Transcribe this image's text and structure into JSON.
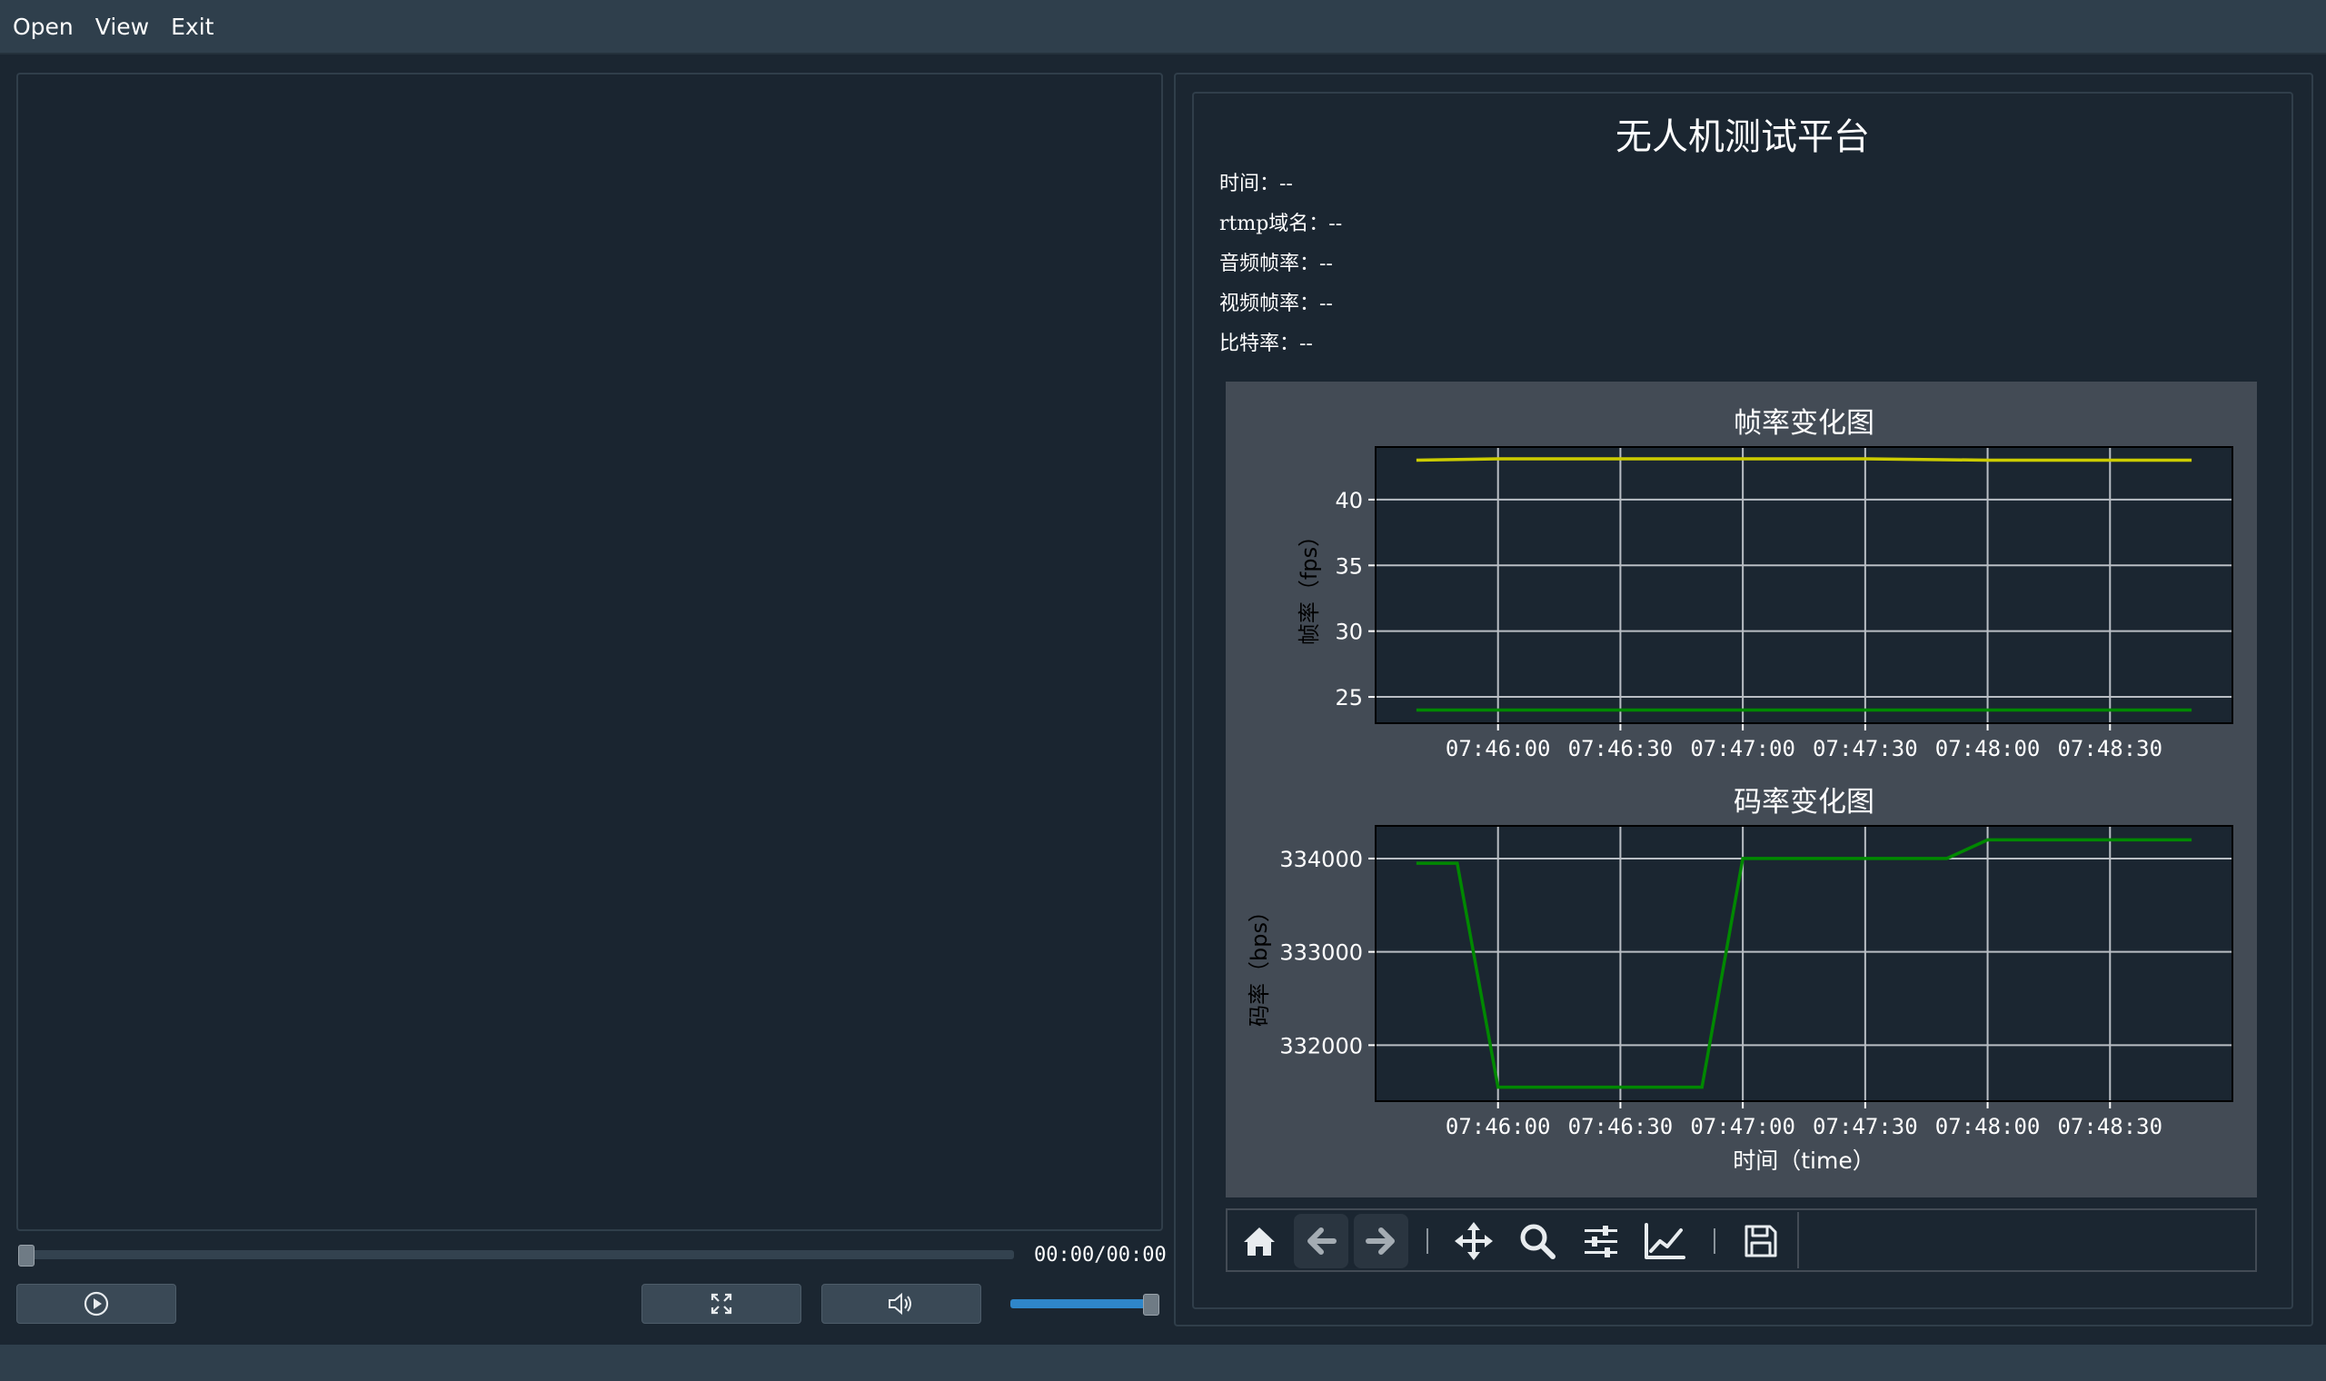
{
  "menu": {
    "items": [
      "Open",
      "View",
      "Exit"
    ]
  },
  "player": {
    "time_display": "00:00/00:00",
    "progress": 0,
    "volume": 1.0,
    "play_icon": "play-icon",
    "fullscreen_icon": "fullscreen-icon",
    "volume_icon": "speaker-icon"
  },
  "info": {
    "title": "无人机测试平台",
    "time_line": "时间：--",
    "rtmp_line": "rtmp域名：--",
    "audio_fps_line": "音频帧率：--",
    "video_fps_line": "视频帧率：--",
    "bitrate_line": "比特率：--"
  },
  "colors": {
    "fps_series_1": "#cccc00",
    "fps_series_2": "#008800",
    "bitrate_series": "#008800",
    "plot_background": "#1b2631",
    "figure_background": "#434b55"
  },
  "chart_data": [
    {
      "type": "line",
      "title": "帧率变化图",
      "xlabel": "",
      "ylabel": "帧率（fps）",
      "x_ticks": [
        "07:46:00",
        "07:46:30",
        "07:47:00",
        "07:47:30",
        "07:48:00",
        "07:48:30"
      ],
      "x_tick_seconds": [
        0,
        30,
        60,
        90,
        120,
        150
      ],
      "xlim_seconds": [
        -30,
        180
      ],
      "ylim": [
        23,
        44
      ],
      "yticks": [
        25,
        30,
        35,
        40
      ],
      "grid": true,
      "series": [
        {
          "x_seconds": [
            -20,
            0,
            30,
            60,
            90,
            120,
            150,
            170
          ],
          "values": [
            43,
            43.1,
            43.1,
            43.1,
            43.1,
            43,
            43,
            43
          ],
          "color": "#cccc00"
        },
        {
          "x_seconds": [
            -20,
            0,
            30,
            60,
            90,
            120,
            150,
            170
          ],
          "values": [
            24,
            24,
            24,
            24,
            24,
            24,
            24,
            24
          ],
          "color": "#008800"
        }
      ]
    },
    {
      "type": "line",
      "title": "码率变化图",
      "xlabel": "时间（time）",
      "ylabel": "码率（bps）",
      "x_ticks": [
        "07:46:00",
        "07:46:30",
        "07:47:00",
        "07:47:30",
        "07:48:00",
        "07:48:30"
      ],
      "x_tick_seconds": [
        0,
        30,
        60,
        90,
        120,
        150
      ],
      "xlim_seconds": [
        -30,
        180
      ],
      "ylim": [
        331400,
        334350
      ],
      "yticks": [
        332000,
        333000,
        334000
      ],
      "grid": true,
      "series": [
        {
          "x_seconds": [
            -20,
            -10,
            0,
            50,
            60,
            110,
            120,
            170
          ],
          "values": [
            333950,
            333950,
            331550,
            331550,
            334000,
            334000,
            334200,
            334200
          ],
          "color": "#008800"
        }
      ]
    }
  ]
}
